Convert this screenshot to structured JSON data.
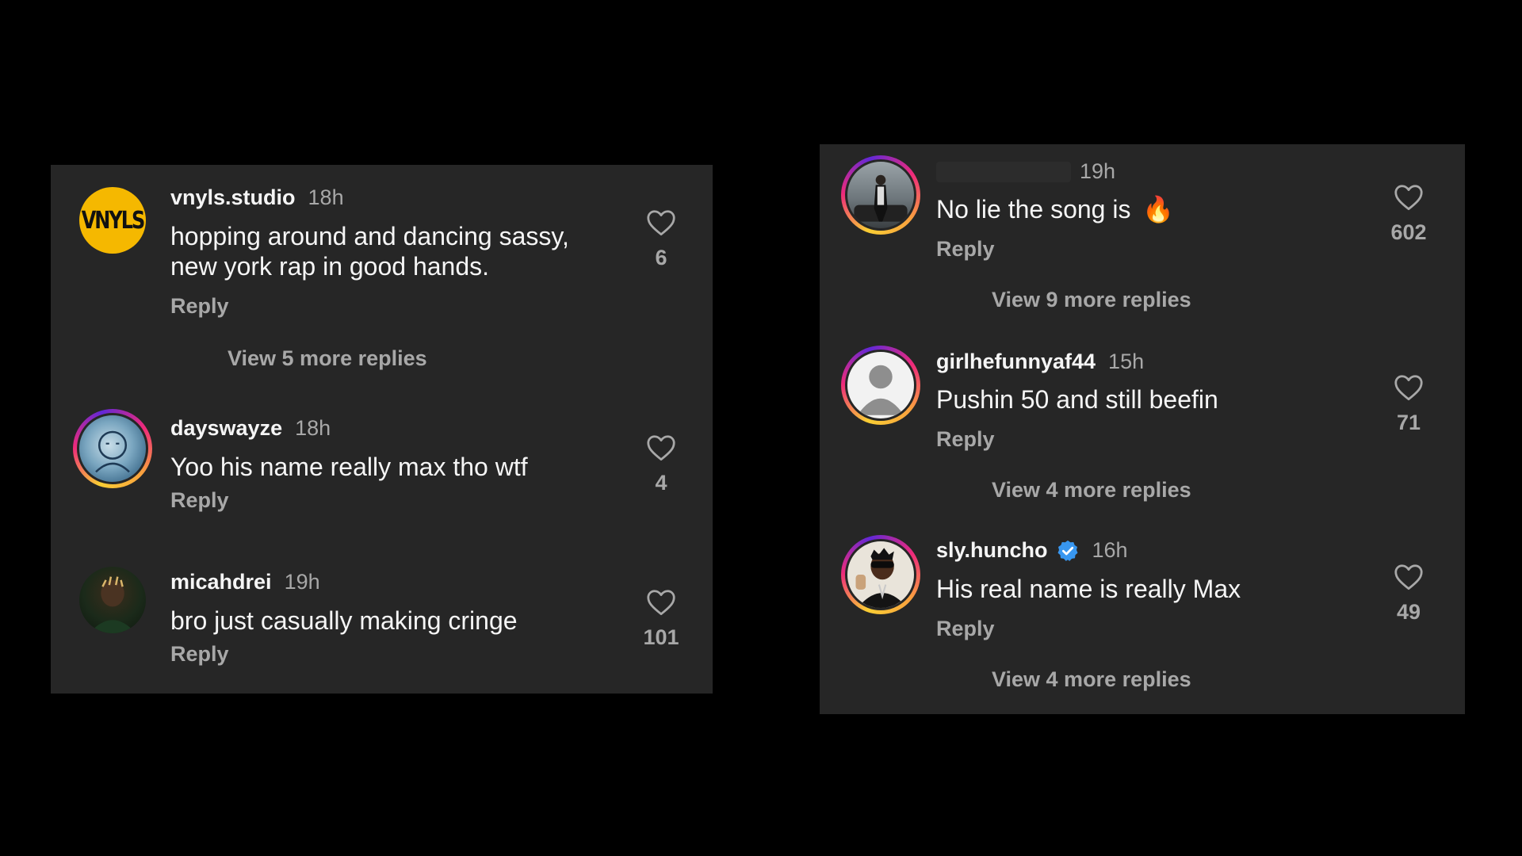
{
  "left_panel": {
    "comments": [
      {
        "username": "vnyls.studio",
        "time": "18h",
        "text_line1": "hopping around and dancing sassy,",
        "text_line2": "new york rap in good hands.",
        "reply": "Reply",
        "likes": "6",
        "view_more": "View 5 more replies",
        "avatar_text": "VNYLS"
      },
      {
        "username": "dayswayze",
        "time": "18h",
        "text": "Yoo his name really max tho wtf",
        "reply": "Reply",
        "likes": "4"
      },
      {
        "username": "micahdrei",
        "time": "19h",
        "text": "bro just casually making cringe",
        "reply": "Reply",
        "likes": "101"
      }
    ]
  },
  "right_panel": {
    "comments": [
      {
        "time": "19h",
        "text": "No lie the song is",
        "emoji": "🔥",
        "reply": "Reply",
        "likes": "602",
        "view_more": "View 9 more replies"
      },
      {
        "username": "girlhefunnyaf44",
        "time": "15h",
        "text": "Pushin 50 and still beefin",
        "reply": "Reply",
        "likes": "71",
        "view_more": "View 4 more replies"
      },
      {
        "username": "sly.huncho",
        "time": "16h",
        "text": "His real name is really Max",
        "reply": "Reply",
        "likes": "49",
        "view_more": "View 4 more replies",
        "verified": true
      }
    ]
  },
  "colors": {
    "background": "#000000",
    "panel": "#262626",
    "primary_text": "#f5f5f5",
    "secondary_text": "#a8a8a8",
    "verified_blue": "#3897f0",
    "vnyls_yellow": "#f5b800"
  }
}
